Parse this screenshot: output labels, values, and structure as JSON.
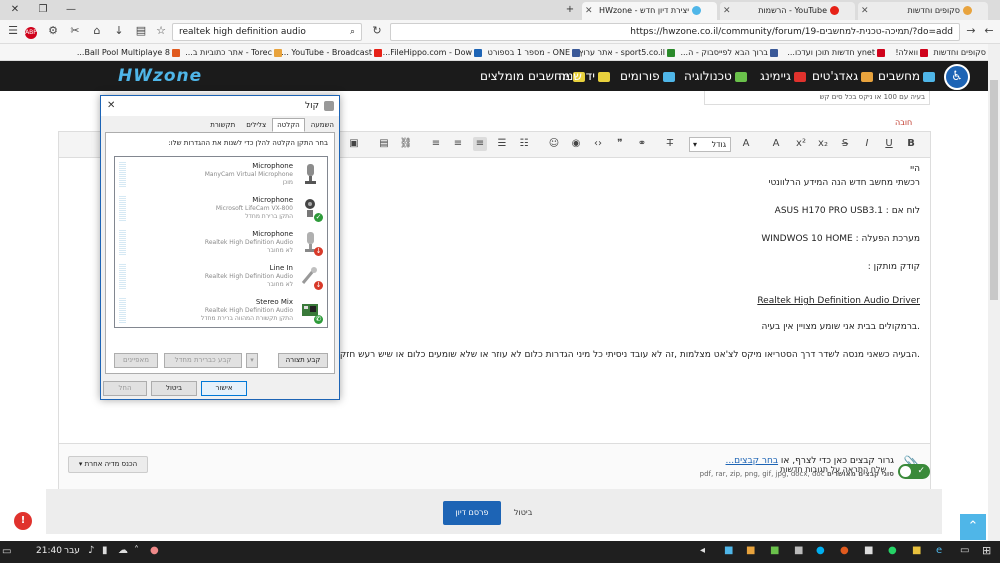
{
  "browser": {
    "tabs": [
      {
        "title": "יצירת דיון חדש - HWzone",
        "active": true
      },
      {
        "title": "YouTube - הרשמות",
        "active": false
      },
      {
        "title": "סקופים וחדשות",
        "active": false
      }
    ],
    "url": "https://hwzone.co.il/community/forum/19-תמיכה-טכנית-למחשבים/?do=add",
    "search_value": "realtek high definition audio",
    "bookmarks": [
      "סקופים וחדשות",
      "וואלה!",
      "ynet חדשות תוכן ועדכו...",
      "ברוך הבא לפייסבוק - ה...",
      "sport5.co.il - אתר ערוץ...",
      "ONE - מספר 1 בספורט",
      "FileHippo.com - Dow...",
      "YouTube - Broadcast ...",
      "Torec - אתר כתוביות ב...",
      "8 Ball Pool Multiplaye..."
    ]
  },
  "site": {
    "logo": "HWzone",
    "nav": [
      {
        "label": "מחשבים"
      },
      {
        "label": "גאדג'טים"
      },
      {
        "label": "גיימינג"
      },
      {
        "label": "טכנולוגיה"
      },
      {
        "label": "פורומים"
      },
      {
        "label": "יד שניה"
      },
      {
        "label": "מחשבים מומלצים"
      }
    ]
  },
  "form": {
    "top_hint": "בעיה עם 100 או ניקס בכל סים קש",
    "required": "חובה",
    "font_size_label": "גודל",
    "content": [
      "היי",
      "רכשתי מחשב חדש הנה המידע הרלוונטי",
      "לוח אם : ASUS H170 PRO USB3.1",
      "מערכת הפעלה : WINDWOS 10 HOME",
      "קודק מותקן :",
      "Realtek High Definition Audio Driver",
      ".ברמקולים בבית אני שומע מצויין אין בעיה",
      ".הבעיה כשאני מנסה לשדר דרך הסטריאו מיקס לצ'אט מצלמות ,זה לא עובד ניסיתי כל מיני הגדרות כלום לא עוזר או שלא שומעים כלום או שיש רעש חזק בלבד"
    ],
    "attach_title_prefix": "גרור קבצים כאן כדי לצרף, או ",
    "attach_link": "בחר קבצים...",
    "attach_types_label": "סוגי קבצים מאושרים",
    "attach_types": "pdf, rar, zip, png, gif, jpg, docx, doc",
    "media_button": "הכנס מדיה אחרת",
    "notify_label": "שלח התראה על תגובות חדשות",
    "publish": "פרסם דיון",
    "cancel": "ביטול",
    "notif_count": "!"
  },
  "sound_dialog": {
    "title": "קול",
    "tabs": [
      "השמעה",
      "הקלטה",
      "צלילים",
      "תקשורת"
    ],
    "active_tab": "הקלטה",
    "hint": "בחר התקן הקלטה להלן כדי לשנות את ההגדרות שלו:",
    "devices": [
      {
        "name": "Microphone",
        "sub": "ManyCam Virtual Microphone",
        "status": "מוכן",
        "badge": ""
      },
      {
        "name": "Microphone",
        "sub": "Microsoft LifeCam VX-800",
        "status": "התקן ברירת מחדל",
        "badge": "green"
      },
      {
        "name": "Microphone",
        "sub": "Realtek High Definition Audio",
        "status": "לא מחובר",
        "badge": "red"
      },
      {
        "name": "Line In",
        "sub": "Realtek High Definition Audio",
        "status": "לא מחובר",
        "badge": "red"
      },
      {
        "name": "Stereo Mix",
        "sub": "Realtek High Definition Audio",
        "status": "התקן תקשורת המהווה ברירת מחדל",
        "badge": "green-phone"
      }
    ],
    "configure": "קבע תצורה",
    "set_default": "קבע כברירת מחדל",
    "properties": "מאפיינים",
    "ok": "אישור",
    "cancel": "ביטול",
    "apply": "החל"
  },
  "taskbar": {
    "time": "21:40",
    "lang": "עבר"
  },
  "colors": {
    "accent": "#1d64b5",
    "nav_bg": "#1b1b1b",
    "logo_accent": "#4fb6e8"
  }
}
